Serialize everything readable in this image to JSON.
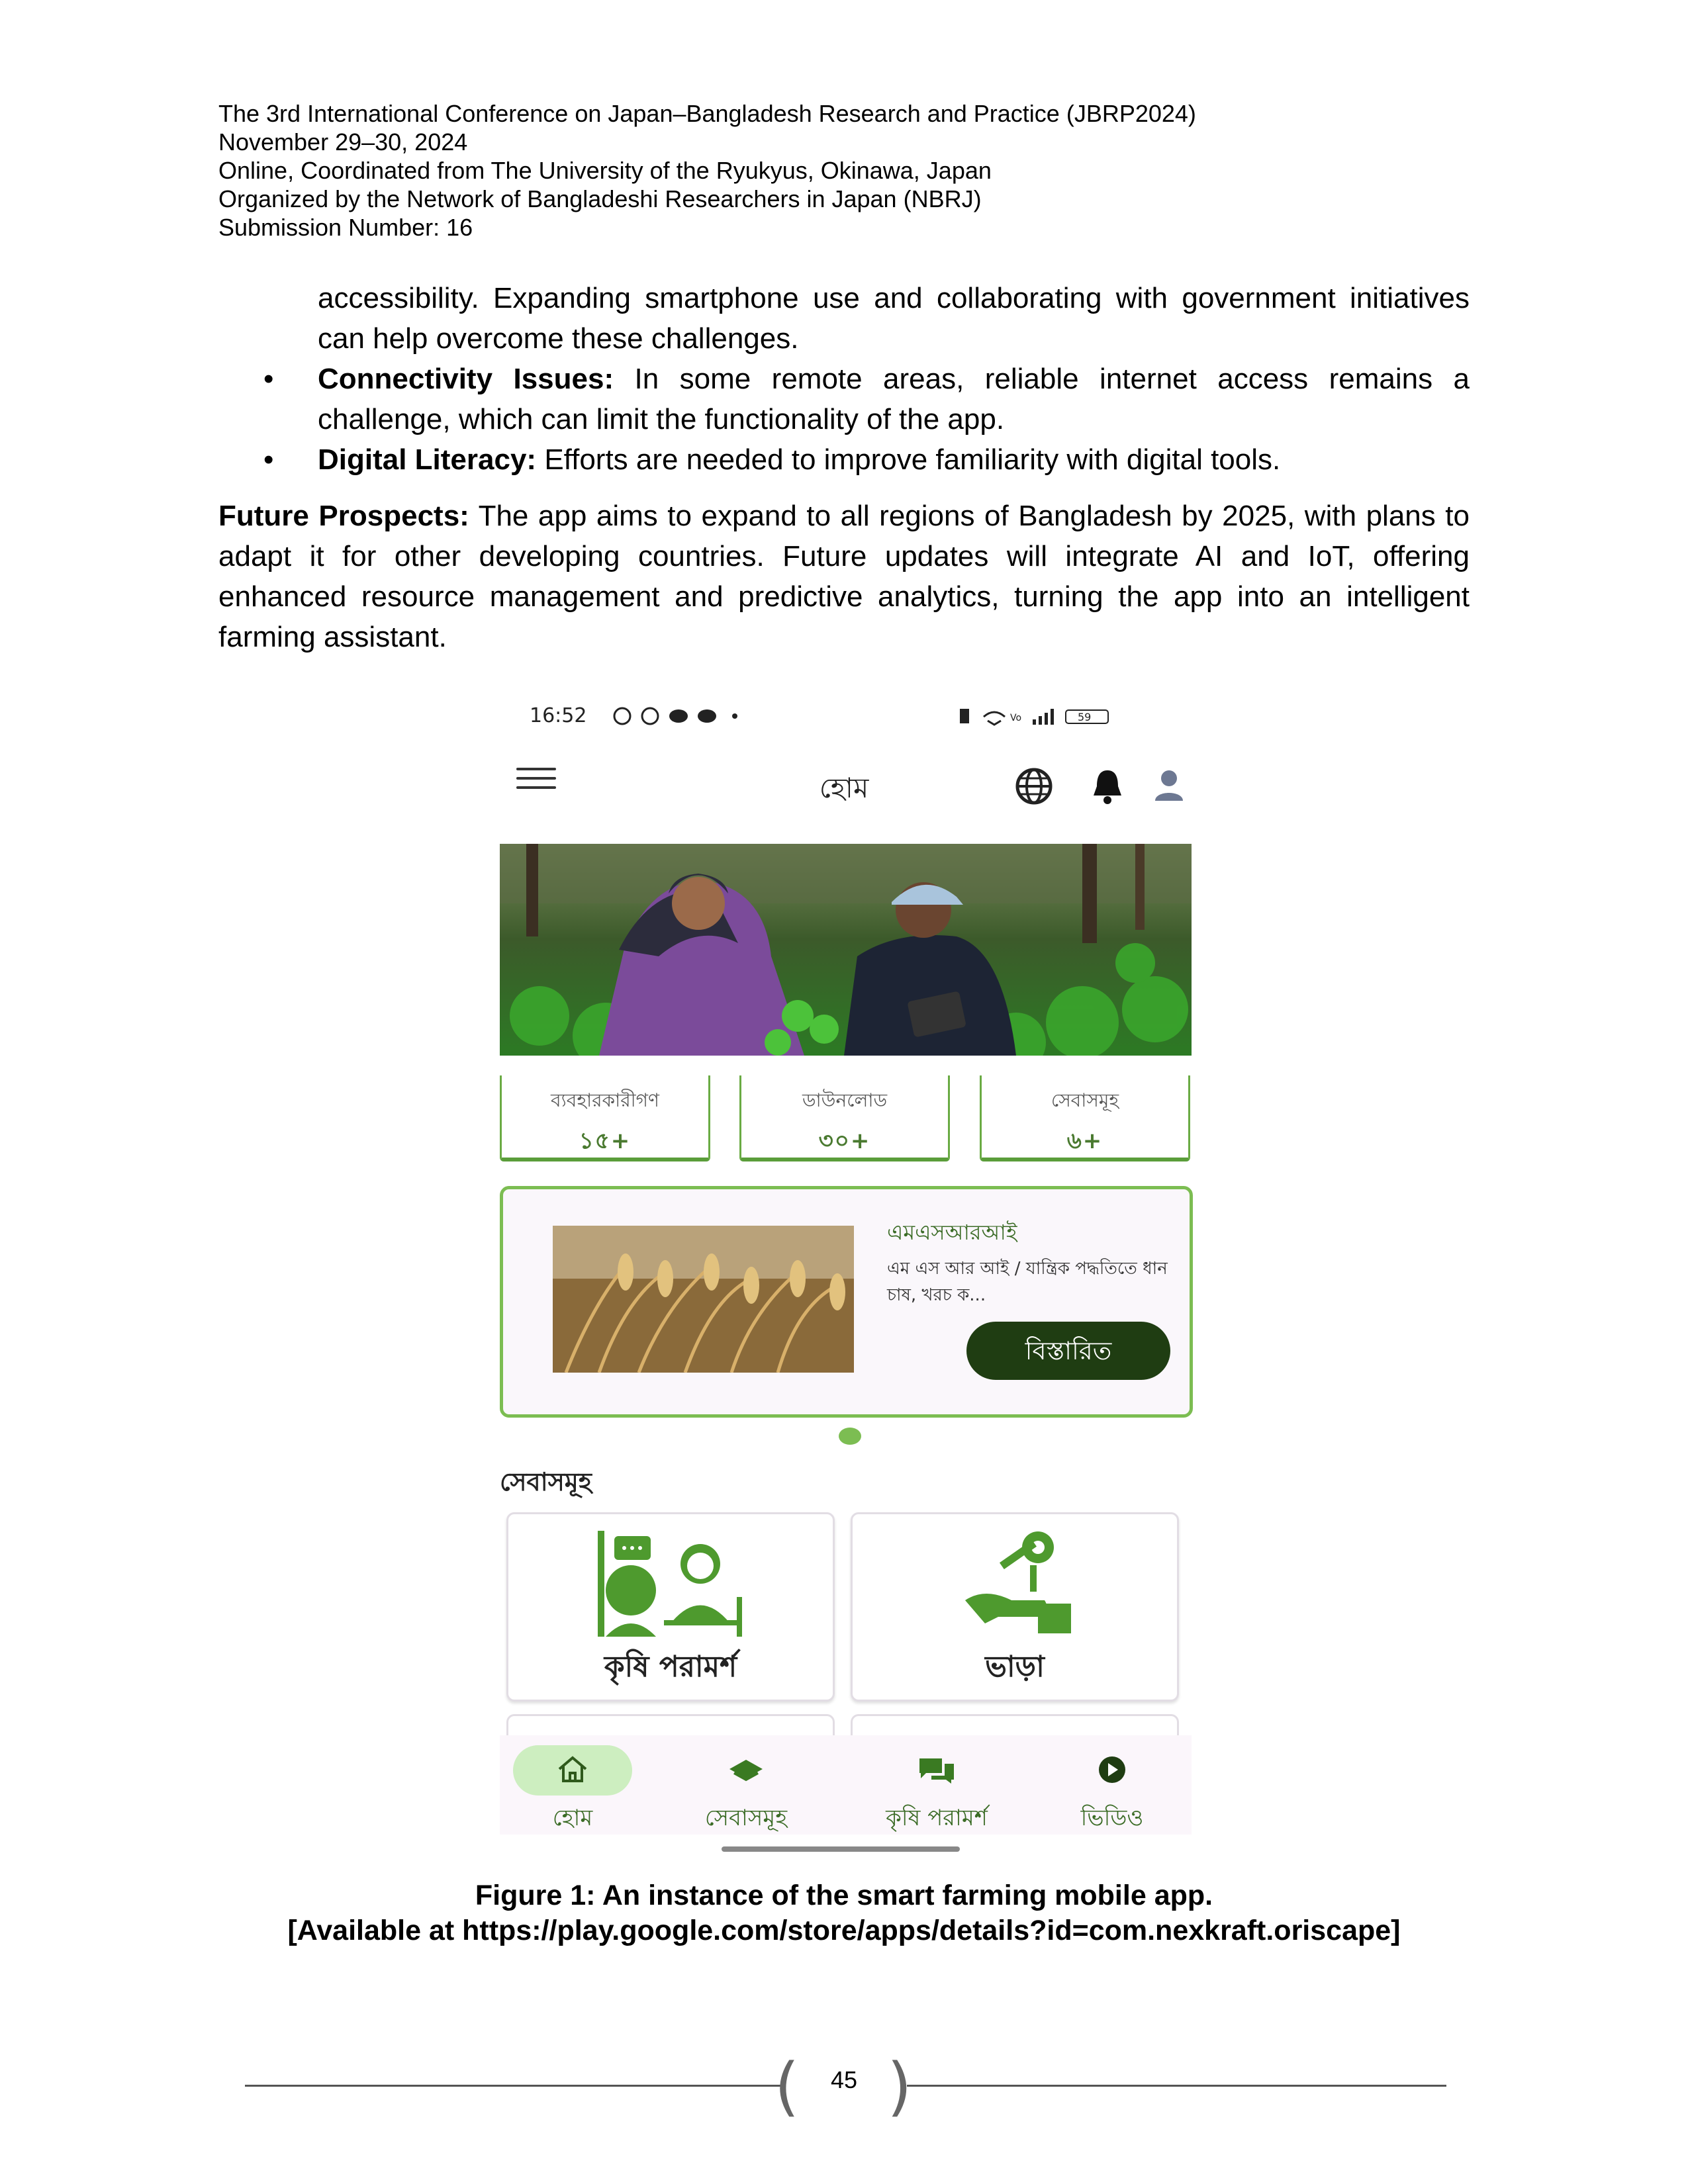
{
  "header": {
    "line1": "The 3rd International Conference on Japan–Bangladesh Research and Practice (JBRP2024)",
    "line2": "November 29–30, 2024",
    "line3": "Online, Coordinated from The University of the Ryukyus, Okinawa, Japan",
    "line4": "Organized by the Network of Bangladeshi Researchers in Japan (NBRJ)",
    "line5": "Submission Number: 16"
  },
  "body": {
    "continued": "accessibility. Expanding smartphone use and collaborating with government initiatives can help overcome these challenges.",
    "bullets": [
      {
        "title": "Connectivity Issues:",
        "text": " In some remote areas, reliable internet access remains a challenge, which can limit the functionality of the app."
      },
      {
        "title": "Digital Literacy:",
        "text": " Efforts are needed to improve familiarity with digital tools."
      }
    ],
    "future_title": "Future Prospects:",
    "future_text": " The app aims to expand to all regions of Bangladesh by 2025, with plans to adapt it for other developing countries. Future updates will integrate AI and IoT, offering enhanced resource management and predictive analytics, turning the app into an intelligent farming assistant."
  },
  "phone": {
    "time": "16:52",
    "battery": "59",
    "title": "হোম",
    "stats": [
      {
        "label": "ব্যবহারকারীগণ",
        "value": "১৫+"
      },
      {
        "label": "ডাউনলোড",
        "value": "৩০+"
      },
      {
        "label": "সেবাসমূহ",
        "value": "৬+"
      }
    ],
    "promo": {
      "title": "এমএসআরআই",
      "desc": "এম এস আর আই / যান্ত্রিক পদ্ধতিতে ধান চাষ, খরচ ক...",
      "button": "বিস্তারিত"
    },
    "services_heading": "সেবাসমূহ",
    "services": [
      "কৃষি পরামর্শ",
      "ভাড়া"
    ],
    "nav": [
      "হোম",
      "সেবাসমূহ",
      "কৃষি পরামর্শ",
      "ভিডিও"
    ],
    "accent": "#5a9d3a",
    "dark_green": "#1f3d12"
  },
  "caption": {
    "line1": "Figure 1: An instance of the smart farming mobile app.",
    "line2": "[Available at https://play.google.com/store/apps/details?id=com.nexkraft.oriscape]"
  },
  "page_number": "45"
}
